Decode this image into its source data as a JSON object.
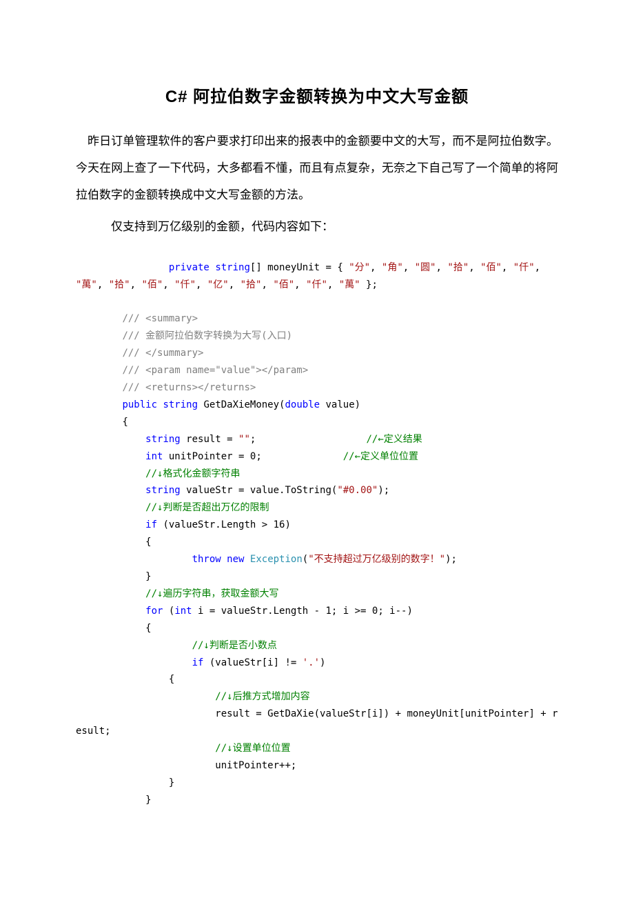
{
  "title": "C# 阿拉伯数字金额转换为中文大写金额",
  "intro": "昨日订单管理软件的客户要求打印出来的报表中的金额要中文的大写，而不是阿拉伯数字。今天在网上查了一下代码，大多都看不懂，而且有点复杂，无奈之下自己写了一个简单的将阿拉伯数字的金额转换成中文大写金额的方法。",
  "subnote": "仅支持到万亿级别的金额，代码内容如下：",
  "code": {
    "decl_pre": "                ",
    "decl_private": "private",
    "decl_string": "string",
    "decl_name": "[] moneyUnit = { ",
    "units": [
      "\"分\"",
      "\"角\"",
      "\"圆\"",
      "\"拾\"",
      "\"佰\"",
      "\"仟\"",
      "\"萬\"",
      "\"拾\"",
      "\"佰\"",
      "\"仟\"",
      "\"亿\"",
      "\"拾\"",
      "\"佰\"",
      "\"仟\"",
      "\"萬\""
    ],
    "decl_end": " };",
    "sum_open": "/// <summary>",
    "sum_line": "/// 金额阿拉伯数字转换为大写(入口)",
    "sum_close": "/// </summary>",
    "param_line": "/// <param name=\"value\"></param>",
    "returns_line": "/// <returns></returns>",
    "sig_public": "public",
    "sig_string": "string",
    "sig_name": " GetDaXieMoney(",
    "sig_double": "double",
    "sig_val": " value)",
    "brace_o": "        {",
    "r_string": "string",
    "r_decl": " result = ",
    "r_empty": "\"\"",
    "r_semi": ";                   ",
    "r_comment": "//←定义结果",
    "u_int": "int",
    "u_decl": " unitPointer = 0;              ",
    "u_comment": "//←定义单位位置",
    "fmt_comment": "//↓格式化金额字符串",
    "vs_string": "string",
    "vs_decl": " valueStr = value.ToString(",
    "vs_fmt": "\"#0.00\"",
    "vs_end": ");",
    "limit_comment": "//↓判断是否超出万亿的限制",
    "if_kw": "if",
    "if_cond": " (valueStr.Length > 16)",
    "if_open": "            {",
    "throw_kw": "throw",
    "new_kw": "new",
    "exc_type": "Exception",
    "exc_open": "(",
    "exc_msg": "\"不支持超过万亿级别的数字！\"",
    "exc_close": ");",
    "if_close": "            }",
    "loop_comment": "//↓遍历字符串，获取金额大写",
    "for_kw": "for",
    "for_open": " (",
    "for_int": "int",
    "for_rest": " i = valueStr.Length - 1; i >= 0; i--)",
    "for_bopen": "            {",
    "dot_comment": "//↓判断是否小数点",
    "if2_kw": "if",
    "if2_cond": " (valueStr[i] != ",
    "if2_char": "'.'",
    "if2_end": ")",
    "if2_open": "                {",
    "push_comment": "//↓后推方式增加内容",
    "push_line": "                        result = GetDaXie(valueStr[i]) + moneyUnit[unitPointer] + result;",
    "setunit_comment": "//↓设置单位位置",
    "setunit_line": "                        unitPointer++;",
    "if2_close": "                }",
    "for_bclose": "            }"
  }
}
